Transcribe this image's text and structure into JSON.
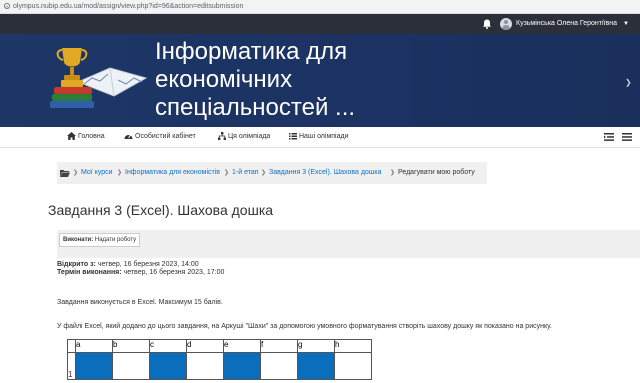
{
  "browser": {
    "url": "olympus.nubip.edu.ua/mod/assign/view.php?id=96&action=editsubmission"
  },
  "topnav": {
    "username": "Кузьмінська Олена Геронтіївна"
  },
  "banner": {
    "title": "Інформатика для економічних спеціальностей ..."
  },
  "menu": {
    "items": [
      {
        "label": "Головна",
        "icon": "home-icon"
      },
      {
        "label": "Особистий кабінет",
        "icon": "dashboard-icon"
      },
      {
        "label": "Ця олімпіада",
        "icon": "sitemap-icon"
      },
      {
        "label": "Наші олімпіади",
        "icon": "list-icon"
      }
    ]
  },
  "breadcrumb": {
    "items": [
      "Мої курси",
      "Інформатика для економістів",
      "1-й етап",
      "Завдання 3 (Excel). Шахова дошка",
      "Редагувати мою роботу"
    ]
  },
  "page": {
    "title": "Завдання 3 (Excel). Шахова дошка"
  },
  "todo": {
    "label": "Виконати:",
    "value": "Надати роботу"
  },
  "dates": {
    "opened_label": "Відкрито з:",
    "opened_value": "четвер, 16 березня 2023, 14:00",
    "due_label": "Термін виконання:",
    "due_value": "четвер, 16 березня 2023, 17:00"
  },
  "description": {
    "line1": "Завдання виконується в Excel. Максимум 15 балів.",
    "line2": "У файлі Excel, який додано до цього завдання, на Аркуші \"Шахи\"  за допомогою умовного форматування створіть шахову дошку як показано на рисунку."
  },
  "sheet": {
    "columns": [
      "a",
      "b",
      "c",
      "d",
      "e",
      "f",
      "g",
      "h"
    ],
    "row_label": "1",
    "row_pattern": [
      "blue",
      "white",
      "blue",
      "white",
      "blue",
      "white",
      "blue",
      "white"
    ]
  },
  "colors": {
    "banner": "#1e3766",
    "topnav": "#2a2f3a",
    "link": "#0f6fc5",
    "square": "#0a6ebd"
  }
}
